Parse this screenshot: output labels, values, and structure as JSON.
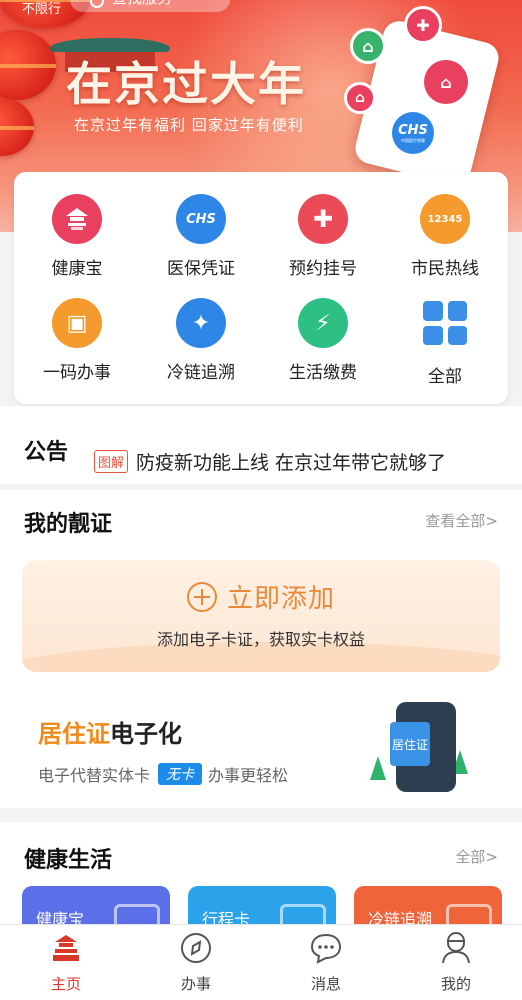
{
  "banner": {
    "limit_text": "不限行",
    "search_placeholder": "查找服务",
    "title": "在京过大年",
    "subtitle": "在京过年有福利  回家过年有便利",
    "phone_badge": "CHS",
    "phone_badge_sub": "中国医疗保障"
  },
  "services": [
    {
      "label": "健康宝",
      "icon": "beijing-health-kit-icon",
      "color": "#e8405e",
      "glyph": "北京健康宝"
    },
    {
      "label": "医保凭证",
      "icon": "medical-insurance-icon",
      "color": "#2e86e6",
      "glyph": "CHS"
    },
    {
      "label": "预约挂号",
      "icon": "appointment-cross-icon",
      "color": "#ea4a56",
      "glyph": "✚"
    },
    {
      "label": "市民热线",
      "icon": "hotline-headset-icon",
      "color": "#f59a2c",
      "glyph": "12345"
    },
    {
      "label": "一码办事",
      "icon": "briefcase-icon",
      "color": "#f59a2c",
      "glyph": "▣"
    },
    {
      "label": "冷链追溯",
      "icon": "cold-chain-shrimp-icon",
      "color": "#2e86e6",
      "glyph": "✦"
    },
    {
      "label": "生活缴费",
      "icon": "payment-lightning-icon",
      "color": "#2dbf84",
      "glyph": "⚡"
    },
    {
      "label": "全部",
      "icon": "all-grid-icon",
      "color": "#3b8fe6",
      "glyph": ""
    }
  ],
  "notice": {
    "title": "公告",
    "tag": "图解",
    "text": "防疫新功能上线 在京过年带它就够了"
  },
  "certificates": {
    "title": "我的靓证",
    "more": "查看全部>",
    "add_label": "立即添加",
    "add_desc": "添加电子卡证，获取实卡权益",
    "promo_title_orange": "居住证",
    "promo_title_dark": "电子化",
    "promo_desc_before": "电子代替实体卡",
    "promo_badge": "无卡",
    "promo_desc_after": "办事更轻松",
    "promo_card_text": "居住证"
  },
  "health": {
    "title": "健康生活",
    "more": "全部>",
    "cards": [
      {
        "label": "健康宝",
        "color": "#5b6fe8"
      },
      {
        "label": "行程卡",
        "color": "#2aa3ea"
      },
      {
        "label": "冷链追溯",
        "color": "#f0643c"
      }
    ]
  },
  "tabbar": {
    "tabs": [
      {
        "label": "主页",
        "icon": "temple-home-icon"
      },
      {
        "label": "办事",
        "icon": "compass-icon"
      },
      {
        "label": "消息",
        "icon": "chat-bubble-icon"
      },
      {
        "label": "我的",
        "icon": "user-profile-icon"
      }
    ]
  }
}
